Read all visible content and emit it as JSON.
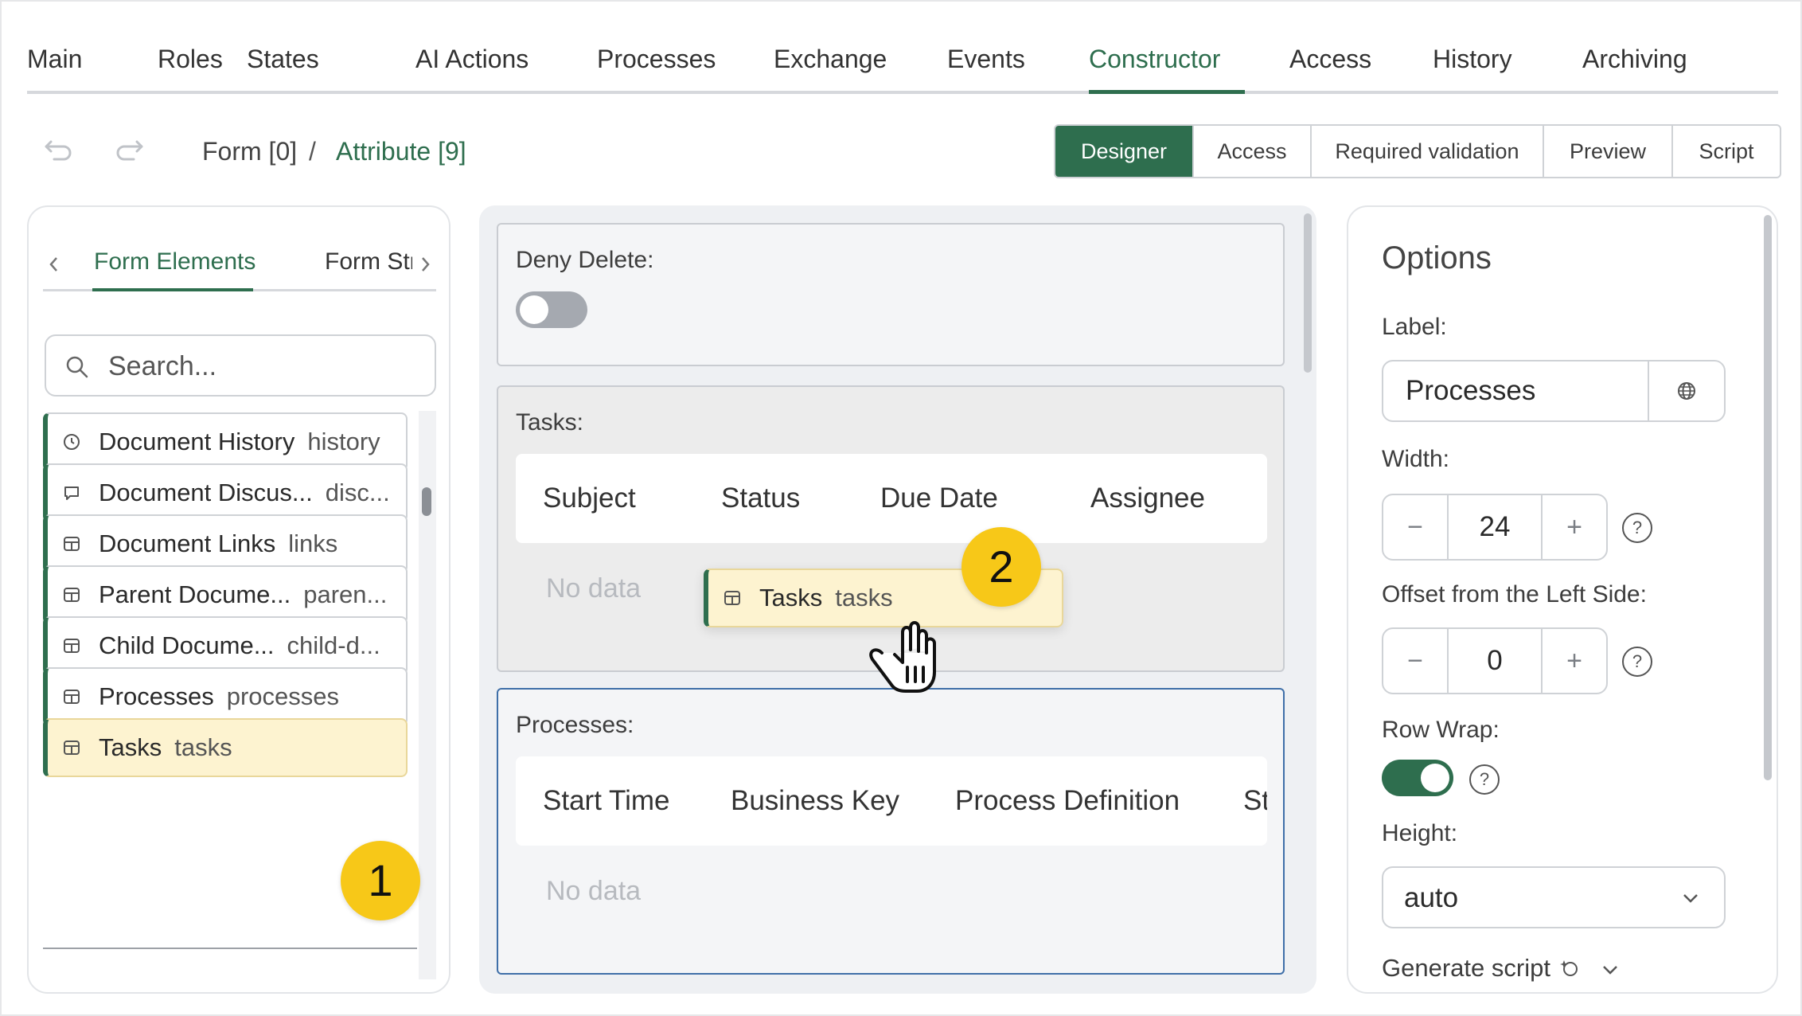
{
  "topnav": {
    "tabs": [
      "Main",
      "Roles",
      "States",
      "AI Actions",
      "Processes",
      "Exchange",
      "Events",
      "Constructor",
      "Access",
      "History",
      "Archiving"
    ],
    "active": "Constructor"
  },
  "breadcrumb": {
    "form": "Form [0]",
    "separator": "/",
    "attribute": "Attribute [9]"
  },
  "mode_tabs": [
    "Designer",
    "Access",
    "Required validation",
    "Preview",
    "Script"
  ],
  "left_panel": {
    "tab_active": "Form Elements",
    "tab_other": "Form Structure",
    "search_placeholder": "Search...",
    "items": [
      {
        "name": "Document History",
        "key": "history",
        "icon": "clock-icon"
      },
      {
        "name": "Document Discus...",
        "key": "disc...",
        "icon": "comment-icon"
      },
      {
        "name": "Document Links",
        "key": "links",
        "icon": "table-icon"
      },
      {
        "name": "Parent Docume...",
        "key": "paren...",
        "icon": "table-icon"
      },
      {
        "name": "Child Docume...",
        "key": "child-d...",
        "icon": "table-icon"
      },
      {
        "name": "Processes",
        "key": "processes",
        "icon": "table-icon"
      },
      {
        "name": "Tasks",
        "key": "tasks",
        "icon": "table-icon"
      }
    ]
  },
  "badges": {
    "one": "1",
    "two": "2"
  },
  "canvas": {
    "deny_delete": {
      "label": "Deny Delete:"
    },
    "tasks": {
      "label": "Tasks:",
      "columns": [
        "Subject",
        "Status",
        "Due Date",
        "Assignee"
      ],
      "empty": "No data"
    },
    "processes": {
      "label": "Processes:",
      "columns": [
        "Start Time",
        "Business Key",
        "Process Definition",
        "St"
      ],
      "empty": "No data"
    },
    "dragging": {
      "name": "Tasks",
      "key": "tasks"
    }
  },
  "options": {
    "title": "Options",
    "label_label": "Label:",
    "label_value": "Processes",
    "width_label": "Width:",
    "width_value": "24",
    "offset_label": "Offset from the Left Side:",
    "offset_value": "0",
    "rowwrap_label": "Row Wrap:",
    "height_label": "Height:",
    "height_value": "auto",
    "generate_script": "Generate script",
    "minus": "−",
    "plus": "+",
    "help": "?"
  },
  "colors": {
    "accent": "#2e6e4e",
    "highlight": "#fdf3d0",
    "badge": "#f7c818"
  }
}
